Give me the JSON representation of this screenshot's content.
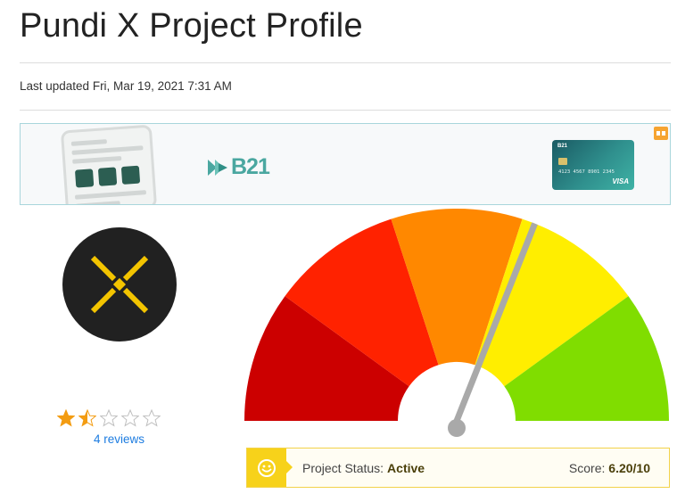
{
  "header": {
    "title": "Pundi X Project Profile",
    "last_updated": "Last updated Fri, Mar 19, 2021 7:31 AM"
  },
  "ad": {
    "brand": "B21",
    "card_brand": "B21",
    "card_number": "4123 4567 8901 2345",
    "card_network": "VISA"
  },
  "project": {
    "logo_icon": "pundi-x-logo-icon",
    "accent_color": "#f7d21a"
  },
  "rating": {
    "stars": 1.5,
    "max_stars": 5,
    "reviews_label": "4 reviews"
  },
  "gauge": {
    "score": 6.2,
    "max": 10,
    "segments": [
      "#cc0000",
      "#ff2200",
      "#ff8800",
      "#ffee00",
      "#80dd00"
    ]
  },
  "status": {
    "label": "Project Status:",
    "value": "Active",
    "score_label": "Score:",
    "score_value": "6.20/10",
    "icon": "smiley-icon"
  }
}
